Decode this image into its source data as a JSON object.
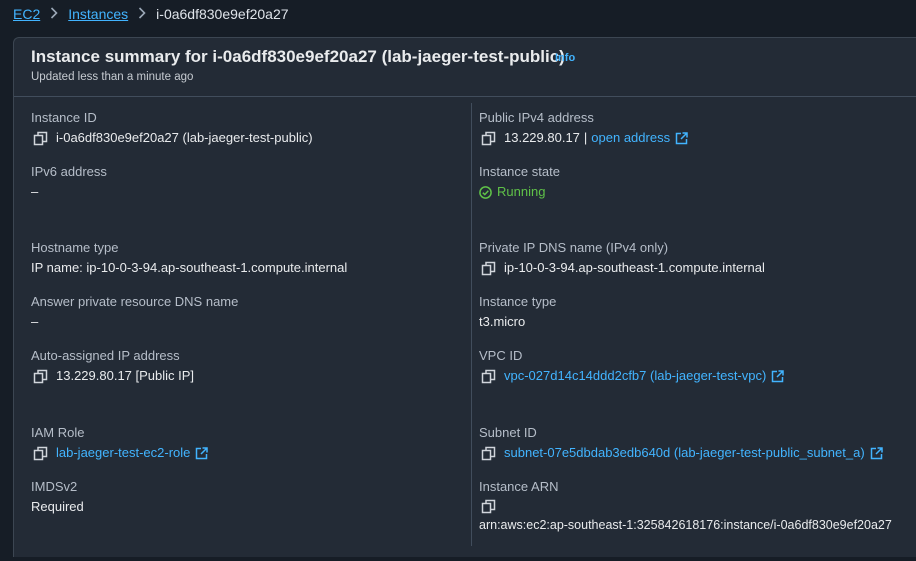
{
  "breadcrumb": {
    "items": [
      "EC2",
      "Instances"
    ],
    "current": "i-0a6df830e9ef20a27"
  },
  "summary": {
    "title": "Instance summary for i-0a6df830e9ef20a27 (lab-jaeger-test-public)",
    "info": "Info",
    "updated": "Updated less than a minute ago"
  },
  "left": {
    "instance_id": {
      "label": "Instance ID",
      "value": "i-0a6df830e9ef20a27 (lab-jaeger-test-public)"
    },
    "ipv6": {
      "label": "IPv6 address",
      "value": "–"
    },
    "hostname_type": {
      "label": "Hostname type",
      "value": "IP name: ip-10-0-3-94.ap-southeast-1.compute.internal"
    },
    "answer_dns": {
      "label": "Answer private resource DNS name",
      "value": "–"
    },
    "auto_ip": {
      "label": "Auto-assigned IP address",
      "value": "13.229.80.17 [Public IP]"
    },
    "iam_role": {
      "label": "IAM Role",
      "value": "lab-jaeger-test-ec2-role"
    },
    "imdsv2": {
      "label": "IMDSv2",
      "value": "Required"
    }
  },
  "right": {
    "public_ipv4": {
      "label": "Public IPv4 address",
      "value": "13.229.80.17",
      "separator": "|",
      "link": "open address"
    },
    "state": {
      "label": "Instance state",
      "value": "Running"
    },
    "private_dns": {
      "label": "Private IP DNS name (IPv4 only)",
      "value": "ip-10-0-3-94.ap-southeast-1.compute.internal"
    },
    "instance_type": {
      "label": "Instance type",
      "value": "t3.micro"
    },
    "vpc_id": {
      "label": "VPC ID",
      "value": "vpc-027d14c14ddd2cfb7 (lab-jaeger-test-vpc)"
    },
    "subnet_id": {
      "label": "Subnet ID",
      "value": "subnet-07e5dbdab3edb640d (lab-jaeger-test-public_subnet_a)"
    },
    "arn": {
      "label": "Instance ARN",
      "value": "arn:aws:ec2:ap-southeast-1:325842618176:instance/i-0a6df830e9ef20a27"
    }
  },
  "colors": {
    "link": "#42b4ff",
    "running": "#5fc148",
    "panel": "#232b36",
    "background": "#161d26"
  },
  "icons": [
    "copy-icon",
    "external-link-icon",
    "chevron-right-icon",
    "check-circle-icon"
  ]
}
